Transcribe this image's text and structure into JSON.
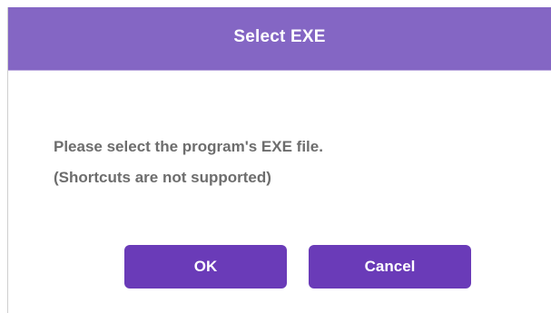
{
  "dialog": {
    "title": "Select EXE",
    "message_line1": "Please select the program's EXE file.",
    "message_line2": "(Shortcuts are not supported)",
    "ok_label": "OK",
    "cancel_label": "Cancel"
  },
  "colors": {
    "title_bar": "#8466c4",
    "button": "#6a3bb8",
    "message_text": "#6d6d6d"
  }
}
